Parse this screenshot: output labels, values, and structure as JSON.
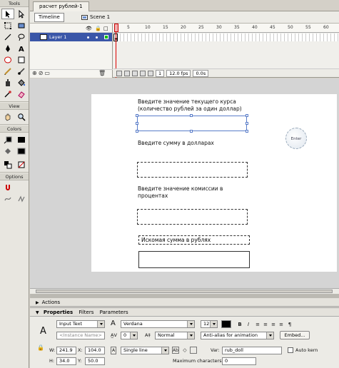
{
  "tools": {
    "title": "Tools",
    "view_title": "View",
    "colors_title": "Colors",
    "options_title": "Options"
  },
  "document": {
    "tab_label": "расчет рублей-1"
  },
  "timeline": {
    "button_label": "Timeline",
    "scene_label": "Scene 1",
    "layer_name": "Layer 1",
    "ruler_ticks": [
      "5",
      "10",
      "15",
      "20",
      "25",
      "30",
      "35",
      "40",
      "45",
      "50",
      "55",
      "60"
    ],
    "current_frame": "1",
    "fps": "12.0 fps",
    "time": "0.0s"
  },
  "stage": {
    "label_rate": "Введите значение текущего курса (количество рублей за один доллар)",
    "label_dollars": "Введите сумму в долларах",
    "label_commission": "Введите значение комиссии в процентах",
    "label_result": "Искомая сумма в рублях",
    "enter_button": "Enter"
  },
  "panels": {
    "actions": "Actions",
    "properties": "Properties",
    "filters": "Filters",
    "parameters": "Parameters"
  },
  "properties": {
    "text_type": "Input Text",
    "instance_name_placeholder": "<Instance Name>",
    "font": "Verdana",
    "font_size": "12",
    "letter_spacing": "0",
    "baseline": "Normal",
    "anti_alias": "Anti-alias for animation",
    "embed_button": "Embed...",
    "line_type": "Single line",
    "var_label": "Var:",
    "var_value": "rub_doll",
    "auto_kern": "Auto kern",
    "max_chars_label": "Maximum characters:",
    "max_chars_value": "0",
    "w_label": "W:",
    "w_value": "241.9",
    "x_label": "X:",
    "x_value": "104.0",
    "h_label": "H:",
    "h_value": "34.0",
    "y_label": "Y:",
    "y_value": "50.0",
    "big_a": "A"
  },
  "colors": {
    "accent": "#3a56a8",
    "playhead": "#dd0000",
    "keyframe_green": "#00c000"
  }
}
